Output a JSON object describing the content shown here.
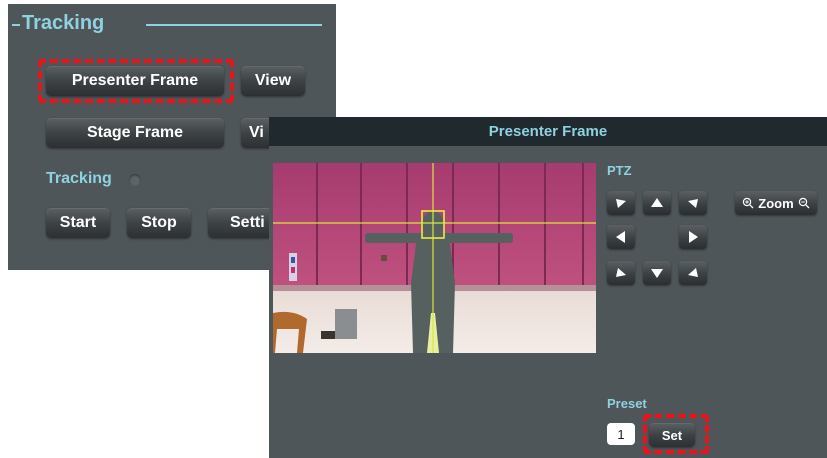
{
  "tracking_panel": {
    "section_title": "Tracking",
    "presenter_frame_label": "Presenter Frame",
    "view_label_1": "View",
    "stage_frame_label": "Stage Frame",
    "view_label_2": "Vi",
    "tracking_label": "Tracking",
    "start_label": "Start",
    "stop_label": "Stop",
    "settings_label": "Setti"
  },
  "dialog": {
    "title": "Presenter Frame",
    "ptz_label": "PTZ",
    "zoom_label": "Zoom",
    "preset_label": "Preset",
    "preset_value": "1",
    "set_label": "Set"
  },
  "icons": {
    "ptz": [
      "arrow-up-left-icon",
      "arrow-up-icon",
      "arrow-up-right-icon",
      "arrow-left-icon",
      "arrow-right-icon",
      "arrow-down-left-icon",
      "arrow-down-icon",
      "arrow-down-right-icon"
    ],
    "zoom": [
      "zoom-in-icon",
      "zoom-out-icon"
    ]
  },
  "colors": {
    "panel_bg": "#4f5659",
    "titlebar_bg": "#202a2e",
    "accent_text": "#8fd1e0",
    "highlight_red": "#e8141c",
    "crosshair": "#d8e640"
  }
}
